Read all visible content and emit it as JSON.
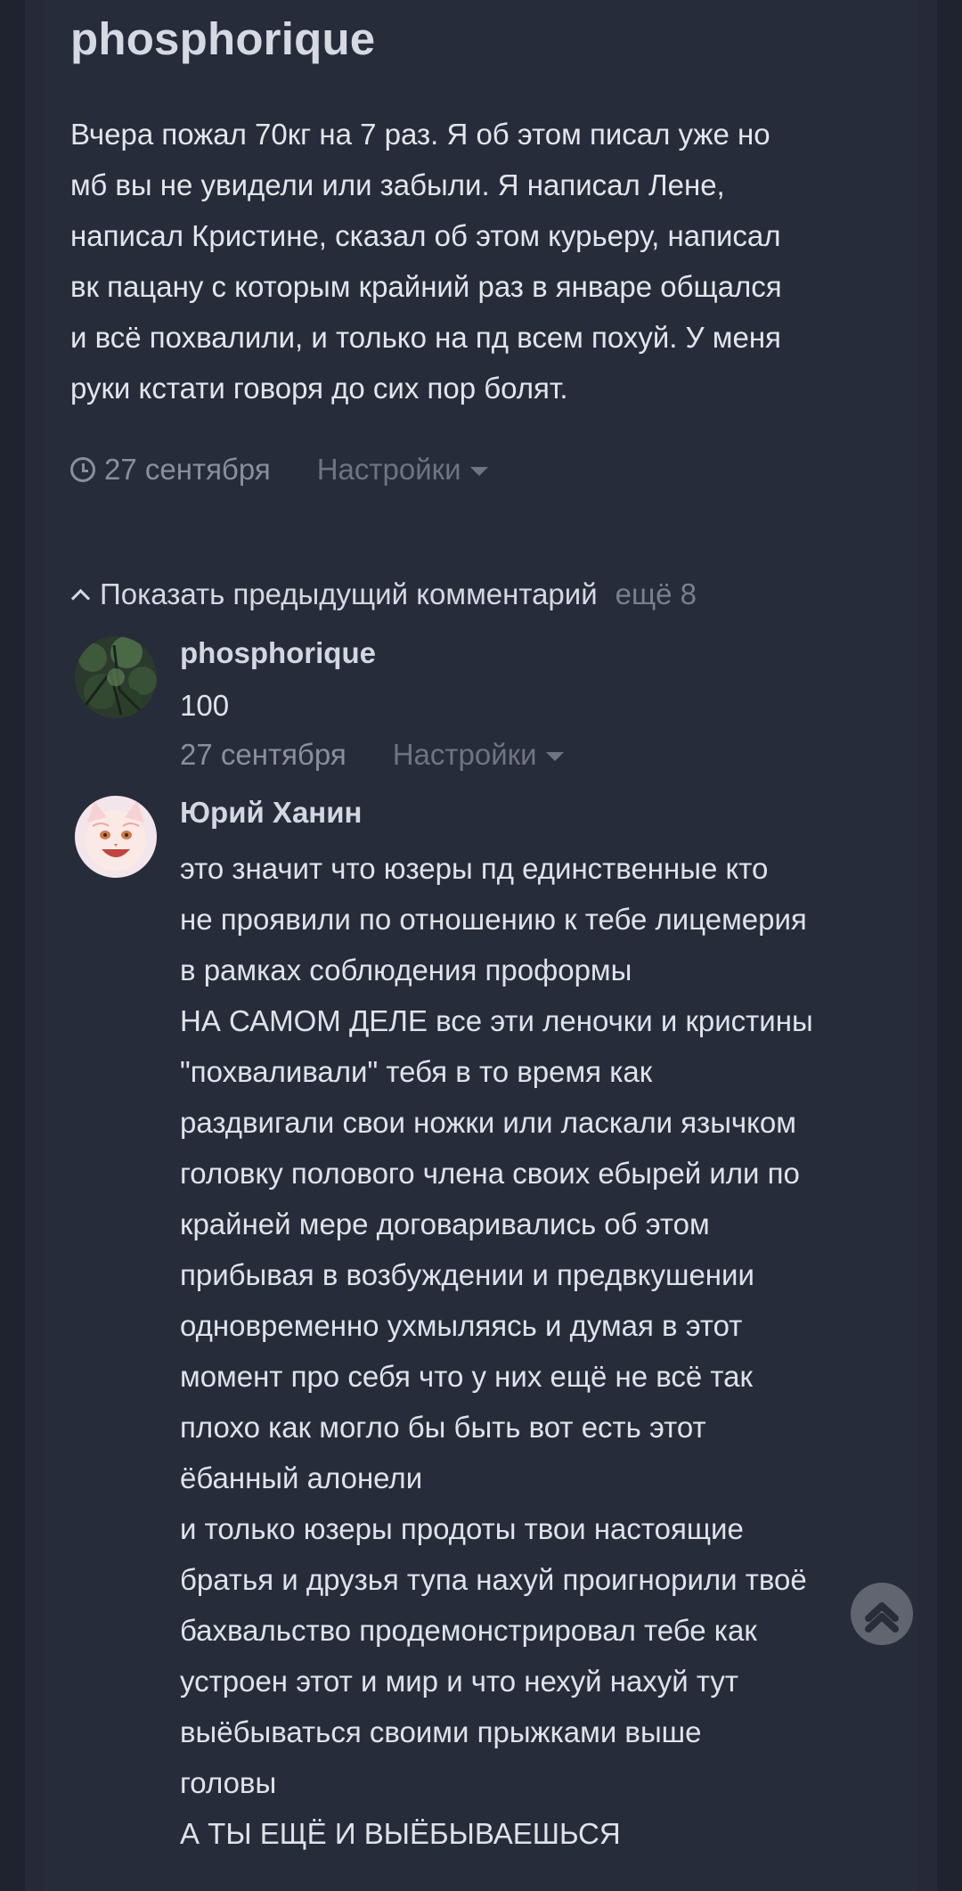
{
  "post": {
    "author": "phosphorique",
    "text": "Вчера пожал 70кг на 7 раз. Я об этом писал уже но\nмб вы не увидели или забыли. Я написал Лене,\nнаписал Кристине, сказал об этом курьеру, написал\nвк пацану с которым крайний раз в январе общался\nи всё похвалили, и только на пд всем похуй. У меня\nруки кстати говоря до сих пор болят.",
    "date": "27 сентября",
    "settings_label": "Настройки"
  },
  "comments_nav": {
    "show_previous_label": "Показать предыдущий комментарий",
    "more_label": "ещё 8"
  },
  "comments": [
    {
      "author": "phosphorique",
      "text": "100",
      "date": "27 сентября",
      "settings_label": "Настройки"
    },
    {
      "author": "Юрий Ханин",
      "text": "это значит что юзеры пд единственные кто\nне проявили по отношению к тебе лицемерия\nв рамках соблюдения проформы\nНА САМОМ ДЕЛЕ все эти леночки и кристины\n\"похваливали\" тебя в то время как\nраздвигали свои ножки или ласкали язычком\nголовку полового члена своих ебырей или по\nкрайней мере договаривались об этом\nприбывая в возбуждении и предвкушении\nодновременно ухмыляясь и думая в этот\nмомент про себя что у них ещё не всё так\nплохо как могло бы быть вот есть этот\nёбанный алонели\nи только юзеры продоты твои настоящие\nбратья и друзья тупа нахуй проигнорили твоё\nбахвальство продемонстрировал тебе как\nустроен этот и мир и что нехуй нахуй тут\nвыёбываться своими прыжками выше\nголовы\nА ТЫ ЕЩЁ И ВЫЁБЫВАЕШЬСЯ"
    }
  ],
  "icons": {
    "clock": "clock-icon",
    "caret": "caret-down-icon",
    "chevron": "chevron-up-icon",
    "scroll_top": "double-chevron-up-icon"
  },
  "colors": {
    "background": "#272c3b",
    "text": "#e3e5eb",
    "muted": "#8a8f9c"
  }
}
